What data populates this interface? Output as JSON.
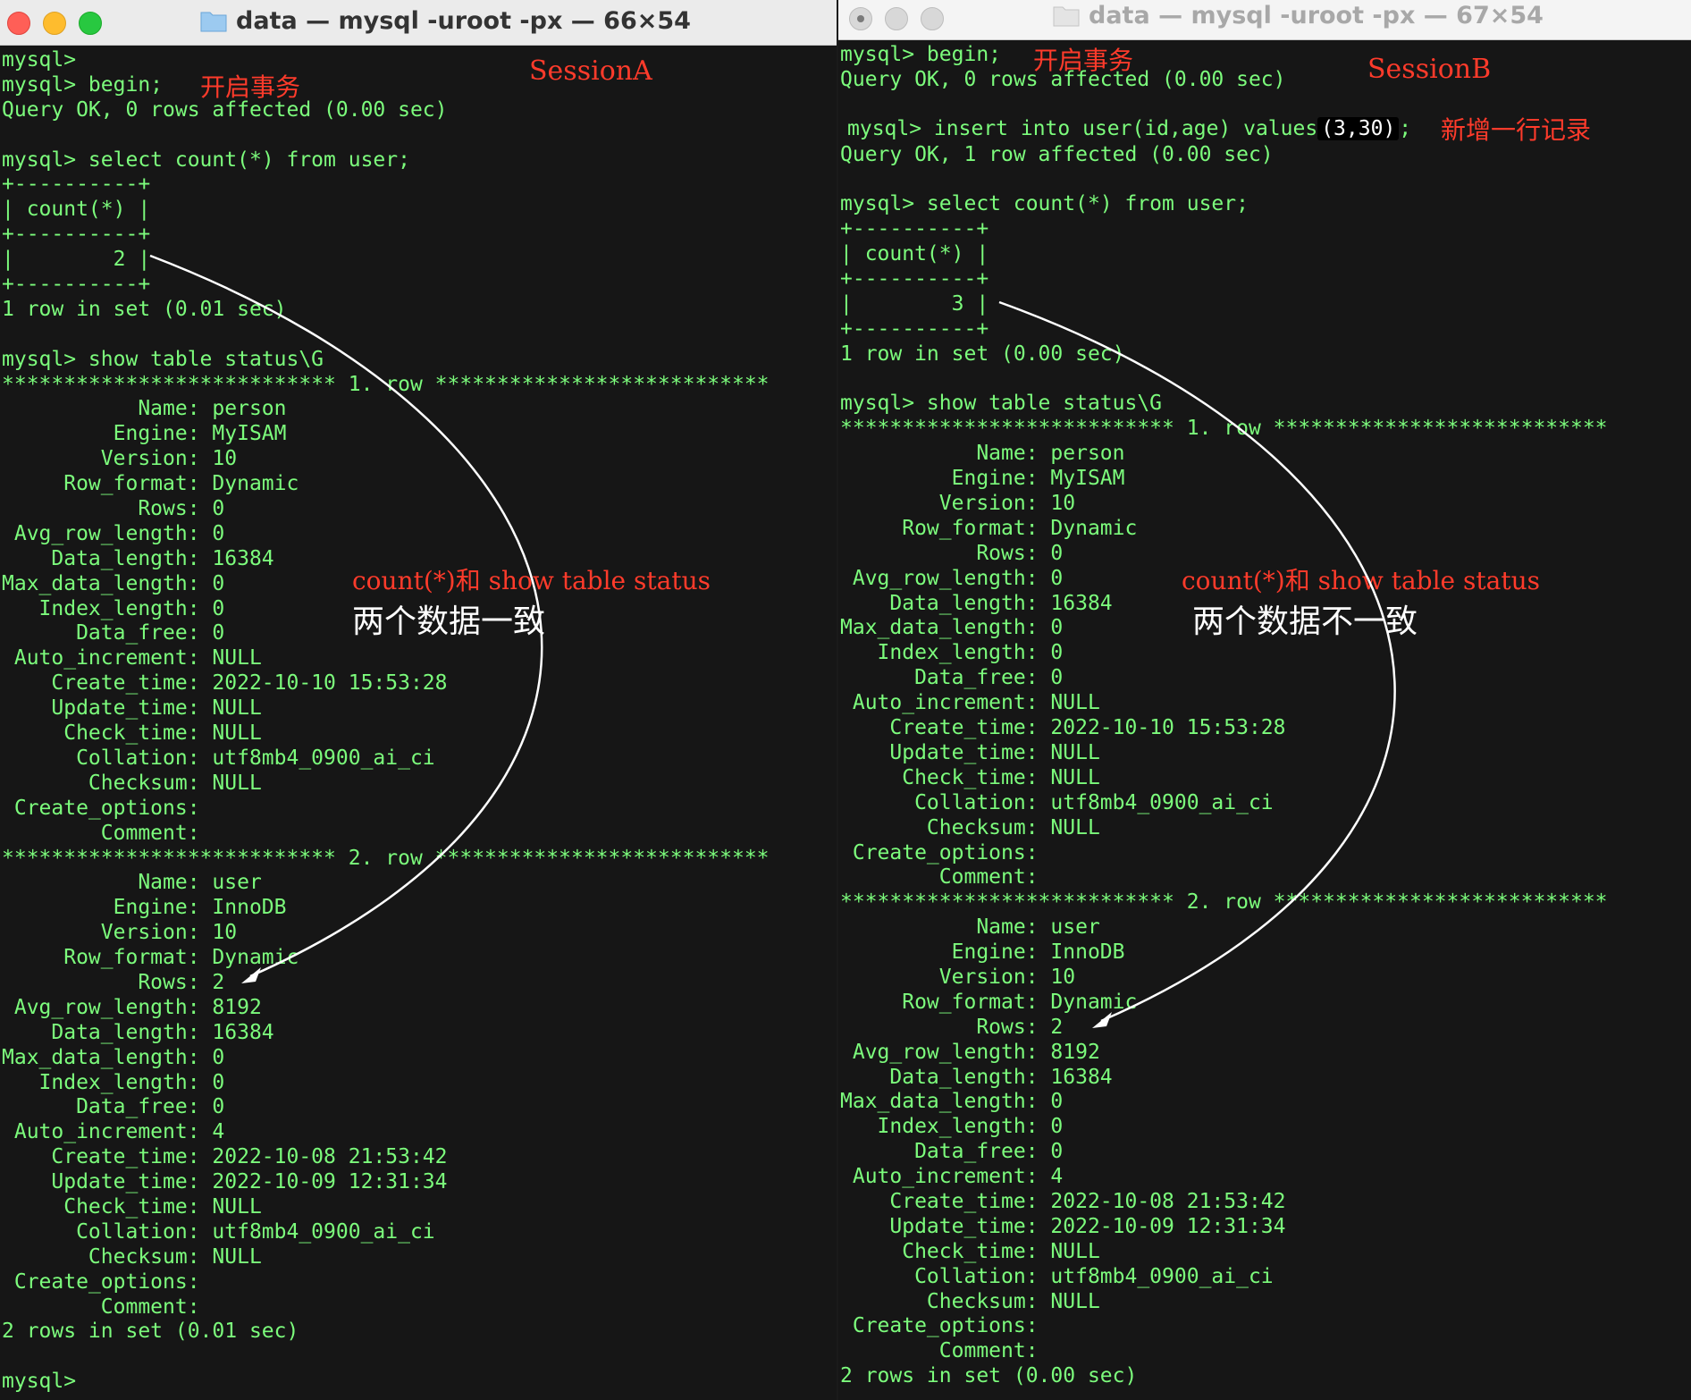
{
  "windowA": {
    "title": "data — mysql -uroot -px — 66×54",
    "session_label": "SessionA",
    "annotation_begin": "开启事务",
    "annotation_line1": "count(*)和 show table status",
    "annotation_line2": "两个数据一致",
    "lines": [
      "mysql>",
      "mysql> begin;",
      "Query OK, 0 rows affected (0.00 sec)",
      "",
      "mysql> select count(*) from user;",
      "+----------+",
      "| count(*) |",
      "+----------+",
      "|        2 |",
      "+----------+",
      "1 row in set (0.01 sec)",
      "",
      "mysql> show table status\\G",
      "*************************** 1. row ***************************",
      "           Name: person",
      "         Engine: MyISAM",
      "        Version: 10",
      "     Row_format: Dynamic",
      "           Rows: 0",
      " Avg_row_length: 0",
      "    Data_length: 16384",
      "Max_data_length: 0",
      "   Index_length: 0",
      "      Data_free: 0",
      " Auto_increment: NULL",
      "    Create_time: 2022-10-10 15:53:28",
      "    Update_time: NULL",
      "     Check_time: NULL",
      "      Collation: utf8mb4_0900_ai_ci",
      "       Checksum: NULL",
      " Create_options: ",
      "        Comment: ",
      "*************************** 2. row ***************************",
      "           Name: user",
      "         Engine: InnoDB",
      "        Version: 10",
      "     Row_format: Dynamic",
      "           Rows: 2",
      " Avg_row_length: 8192",
      "    Data_length: 16384",
      "Max_data_length: 0",
      "   Index_length: 0",
      "      Data_free: 0",
      " Auto_increment: 4",
      "    Create_time: 2022-10-08 21:53:42",
      "    Update_time: 2022-10-09 12:31:34",
      "     Check_time: NULL",
      "      Collation: utf8mb4_0900_ai_ci",
      "       Checksum: NULL",
      " Create_options: ",
      "        Comment: ",
      "2 rows in set (0.01 sec)",
      "",
      "mysql>"
    ]
  },
  "windowB": {
    "title": "data — mysql -uroot -px — 67×54",
    "session_label": "SessionB",
    "annotation_begin": "开启事务",
    "annotation_insert": "新增一行记录",
    "insert_prefix": "mysql> insert into user(id,age) values",
    "insert_values": "(3,30)",
    "insert_suffix": ";",
    "annotation_line1": "count(*)和 show table status",
    "annotation_line2": "两个数据不一致",
    "lines": [
      "mysql> begin;",
      "Query OK, 0 rows affected (0.00 sec)",
      "",
      "",
      "Query OK, 1 row affected (0.00 sec)",
      "",
      "mysql> select count(*) from user;",
      "+----------+",
      "| count(*) |",
      "+----------+",
      "|        3 |",
      "+----------+",
      "1 row in set (0.00 sec)",
      "",
      "mysql> show table status\\G",
      "*************************** 1. row ***************************",
      "           Name: person",
      "         Engine: MyISAM",
      "        Version: 10",
      "     Row_format: Dynamic",
      "           Rows: 0",
      " Avg_row_length: 0",
      "    Data_length: 16384",
      "Max_data_length: 0",
      "   Index_length: 0",
      "      Data_free: 0",
      " Auto_increment: NULL",
      "    Create_time: 2022-10-10 15:53:28",
      "    Update_time: NULL",
      "     Check_time: NULL",
      "      Collation: utf8mb4_0900_ai_ci",
      "       Checksum: NULL",
      " Create_options: ",
      "        Comment: ",
      "*************************** 2. row ***************************",
      "           Name: user",
      "         Engine: InnoDB",
      "        Version: 10",
      "     Row_format: Dynamic",
      "           Rows: 2",
      " Avg_row_length: 8192",
      "    Data_length: 16384",
      "Max_data_length: 0",
      "   Index_length: 0",
      "      Data_free: 0",
      " Auto_increment: 4",
      "    Create_time: 2022-10-08 21:53:42",
      "    Update_time: 2022-10-09 12:31:34",
      "     Check_time: NULL",
      "      Collation: utf8mb4_0900_ai_ci",
      "       Checksum: NULL",
      " Create_options: ",
      "        Comment: ",
      "2 rows in set (0.00 sec)"
    ]
  },
  "colors": {
    "terminal_text": "#7cfc7c",
    "terminal_bg": "#161616",
    "annotation_red": "#ff3b2b",
    "annotation_white": "#ffffff"
  }
}
